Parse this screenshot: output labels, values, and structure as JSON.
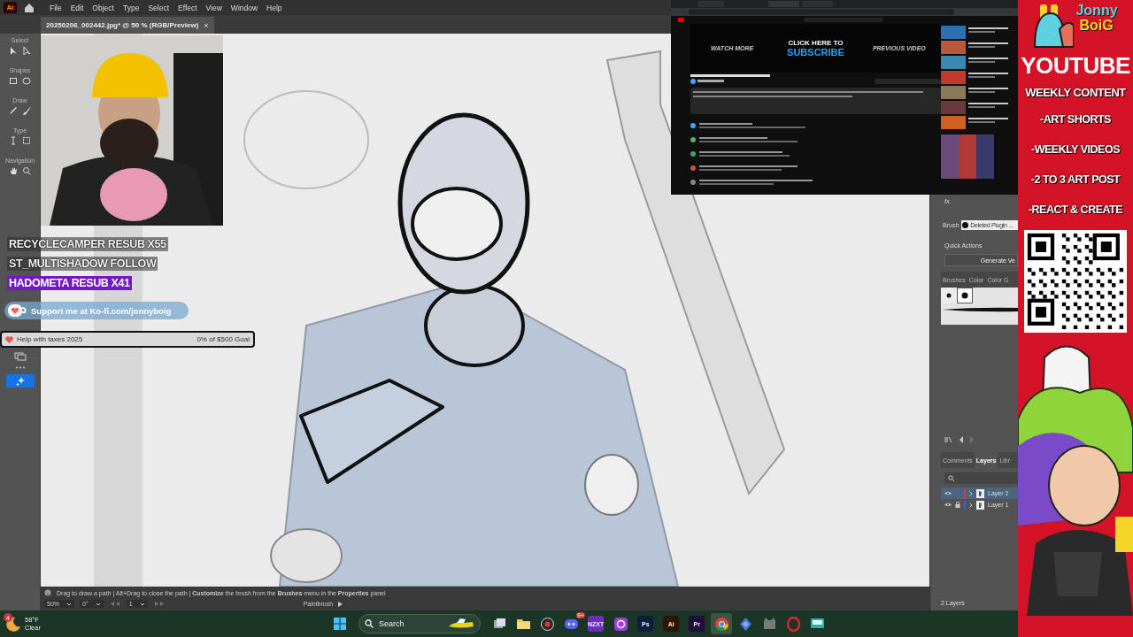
{
  "menu_bar": {
    "logo": "Ai",
    "items": [
      "File",
      "Edit",
      "Object",
      "Type",
      "Select",
      "Effect",
      "View",
      "Window",
      "Help"
    ]
  },
  "document_tab": {
    "title": "20250206_002442.jpg* @ 50 % (RGB/Preview)",
    "close": "×"
  },
  "toolbar": {
    "sections": [
      "Select",
      "Shapes",
      "Draw",
      "Type",
      "Navigation"
    ]
  },
  "status_bar": {
    "hint": "Drag to draw a path  |  Alt+Drag to close the path  |  **Customize** the brush from the **Brushes** menu in the **Properties** panel",
    "zoom": "50%",
    "rotation": "0°",
    "artboard": "1",
    "tool": "Paintbrush"
  },
  "right_panel": {
    "fx": "fx.",
    "brush_label": "Brush",
    "brush_value": "Deleted Plugin ...",
    "quick_actions": "Quick Actions",
    "action_button": "Generate Ve",
    "brush_tabs": [
      "Brushes",
      "Color",
      "Color G"
    ],
    "brush_swatches": [
      {
        "selected": false
      },
      {
        "selected": true
      }
    ],
    "layer_tabs": [
      {
        "label": "Comments",
        "selected": false
      },
      {
        "label": "Layers",
        "selected": true
      },
      {
        "label": "Libr",
        "selected": false
      }
    ],
    "layers": [
      {
        "name": "Layer 2",
        "selected": true,
        "locked": false,
        "color": "#c8404a"
      },
      {
        "name": "Layer 1",
        "selected": false,
        "locked": true,
        "color": "#4a5ad0"
      }
    ],
    "footer": "2 Layers"
  },
  "stream_overlay": {
    "alerts": [
      {
        "text": "RECYCLECAMPER  RESUB X55",
        "highlighted": false
      },
      {
        "text": "ST_MULTISHADOW  FOLLOW",
        "highlighted": false
      },
      {
        "text": "HADOMETA  RESUB X41",
        "highlighted": true
      }
    ],
    "kofi": "Support me at Ko-fi.com/jonnyboig",
    "goal": {
      "title": "Help with taxes 2025",
      "progress": "0% of $500 Goal",
      "level": 0
    }
  },
  "browser_capture": {
    "left": "WATCH MORE",
    "title": "CLICK HERE TO",
    "subscribe": "SUBSCRIBE",
    "right": "PREVIOUS VIDEO"
  },
  "banner": {
    "logo": [
      "Jonny",
      "BoiG"
    ],
    "title": "YOUTUBE",
    "lines": [
      "WEEKLY CONTENT",
      "-ART SHORTS",
      "-WEEKLY VIDEOS",
      "-2 TO 3 ART POST",
      "-REACT & CREATE"
    ]
  },
  "taskbar": {
    "weather": {
      "badge": "4",
      "temperature": "58°F",
      "condition": "Clear"
    },
    "search": "Search",
    "apps": [
      {
        "kind": "box",
        "selected": false
      },
      {
        "kind": "folder",
        "selected": false
      },
      {
        "kind": "record",
        "selected": false
      },
      {
        "kind": "chat",
        "badge": "9+",
        "selected": false
      },
      {
        "kind": "tile",
        "label": "NZXT",
        "color": "#6b2fb8",
        "selected": false
      },
      {
        "kind": "ring",
        "selected": false
      },
      {
        "kind": "tile",
        "label": "Ps",
        "color": "#0a1f3d",
        "selected": false
      },
      {
        "kind": "tile",
        "label": "Ai",
        "color": "#2e1500",
        "selected": false
      },
      {
        "kind": "tile",
        "label": "Pr",
        "color": "#1d0f3a",
        "selected": false
      },
      {
        "kind": "browser",
        "selected": true
      },
      {
        "kind": "diamond",
        "selected": false
      },
      {
        "kind": "cat",
        "selected": false
      },
      {
        "kind": "opera",
        "selected": false
      },
      {
        "kind": "screen",
        "selected": false
      }
    ]
  }
}
